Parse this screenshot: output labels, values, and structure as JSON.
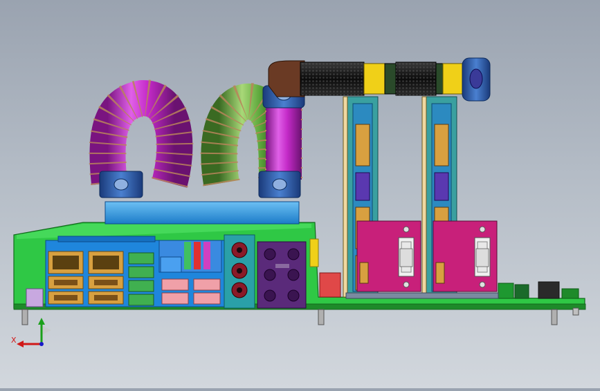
{
  "viewport": {
    "background_top": "#9aa3b0",
    "background_bottom": "#d2d7dd"
  },
  "triad": {
    "x_label": "X"
  },
  "colors": {
    "pcb": "#2fc845",
    "pcb_dark": "#1e8a2a",
    "io_shield": "#1f86dc",
    "gpu_bracket": "#c8207a",
    "audio_panel": "#5a2a7a",
    "teal_panel": "#2aa0a8",
    "tube_magenta": "#c42ac8",
    "tube_green": "#5ea83c",
    "fitting_blue": "#2c5fb0",
    "coil_tan": "#b8845a",
    "block_blue": "#2e9ee6",
    "rad_black": "#1a1a1a",
    "rad_yellow": "#f0d018",
    "elbow_brown": "#6a3a24",
    "end_cap_navy": "#3a3a98"
  },
  "icons": [
    "coordinate-triad-icon",
    "rj45-port-icon",
    "usb-port-icon",
    "audio-jack-icon",
    "dvi-connector-icon",
    "hdmi-connector-icon"
  ]
}
